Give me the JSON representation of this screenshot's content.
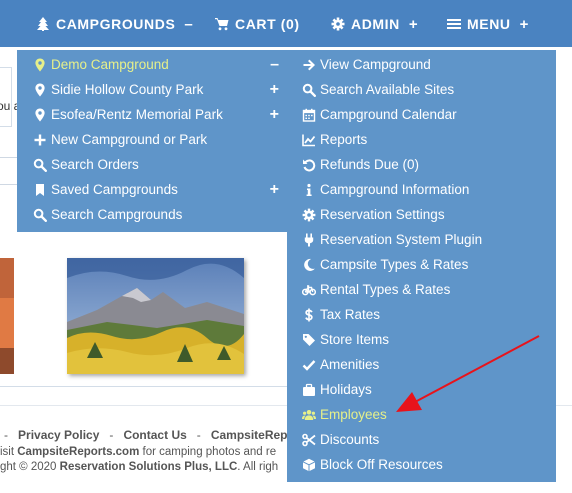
{
  "nav": {
    "campgrounds_label": "CAMPGROUNDS",
    "campgrounds_sign": "–",
    "cart_label": "CART (0)",
    "admin_label": "ADMIN",
    "admin_sign": "+",
    "menu_label": "MENU",
    "menu_sign": "+"
  },
  "background": {
    "left_clip_text": "ou a",
    "footer_links": [
      "-",
      "Privacy Policy",
      "-",
      "Contact Us",
      "-",
      "CampsiteRepor"
    ],
    "footer_line2_prefix": "isit ",
    "footer_line2_site": "CampsiteReports.com",
    "footer_line2_suffix": " for camping photos and re",
    "footer_line3_prefix": "ght © 2020 ",
    "footer_line3_company": "Reservation Solutions Plus, LLC",
    "footer_line3_suffix": ". All righ"
  },
  "campground_menu": {
    "items": [
      {
        "label": "Demo Campground",
        "icon": "map-marker-icon",
        "sign": "–",
        "active": true
      },
      {
        "label": "Sidie Hollow County Park",
        "icon": "map-marker-icon",
        "sign": "+"
      },
      {
        "label": "Esofea/Rentz Memorial Park",
        "icon": "map-marker-icon",
        "sign": "+"
      },
      {
        "label": "New Campground or Park",
        "icon": "plus-icon",
        "sign": ""
      },
      {
        "label": "Search Orders",
        "icon": "search-icon",
        "sign": ""
      },
      {
        "label": "Saved Campgrounds",
        "icon": "bookmark-icon",
        "sign": "+"
      },
      {
        "label": "Search Campgrounds",
        "icon": "search-icon",
        "sign": ""
      }
    ]
  },
  "campground_submenu": {
    "items": [
      {
        "label": "View Campground",
        "icon": "arrow-right-icon"
      },
      {
        "label": "Search Available Sites",
        "icon": "search-icon"
      },
      {
        "label": "Campground Calendar",
        "icon": "calendar-icon"
      },
      {
        "label": "Reports",
        "icon": "chart-icon"
      },
      {
        "label": "Refunds Due (0)",
        "icon": "undo-icon"
      },
      {
        "label": "Campground Information",
        "icon": "info-icon"
      },
      {
        "label": "Reservation Settings",
        "icon": "gear-icon"
      },
      {
        "label": "Reservation System Plugin",
        "icon": "plug-icon"
      },
      {
        "label": "Campsite Types & Rates",
        "icon": "moon-icon"
      },
      {
        "label": "Rental Types & Rates",
        "icon": "bicycle-icon"
      },
      {
        "label": "Tax Rates",
        "icon": "dollar-icon"
      },
      {
        "label": "Store Items",
        "icon": "tags-icon"
      },
      {
        "label": "Amenities",
        "icon": "check-icon"
      },
      {
        "label": "Holidays",
        "icon": "suitcase-icon"
      },
      {
        "label": "Employees",
        "icon": "users-icon",
        "active": true
      },
      {
        "label": "Discounts",
        "icon": "scissors-icon"
      },
      {
        "label": "Block Off Resources",
        "icon": "cube-icon"
      }
    ]
  },
  "colors": {
    "nav_bg": "#4a83c1",
    "menu_bg": "#5f95c9",
    "active_text": "#e6f08a",
    "annotation_arrow": "#e8131b"
  }
}
